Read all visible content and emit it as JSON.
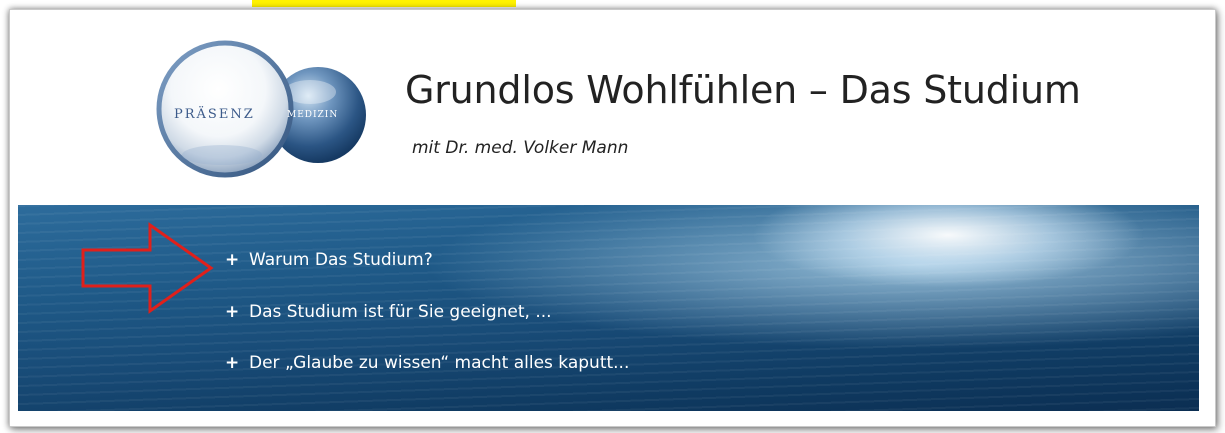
{
  "logo": {
    "word_1": "PRÄSENZ",
    "word_2": "MEDIZIN"
  },
  "header": {
    "title": "Grundlos Wohlfühlen – Das Studium",
    "subtitle": "mit Dr. med. Volker Mann"
  },
  "menu": {
    "bullet": "+",
    "items": [
      {
        "label": "Warum Das Studium?"
      },
      {
        "label": "Das Studium ist für Sie geeignet, ..."
      },
      {
        "label": "Der „Glaube zu wissen“ macht alles kaputt..."
      }
    ]
  },
  "annotation": {
    "arrow_icon": "right-arrow-outline-icon",
    "arrow_color": "#e0201b",
    "highlight_color": "#fff200"
  },
  "colors": {
    "banner_dark": "#0b2e52",
    "banner_mid": "#1f5a88",
    "text_dark": "#222222"
  }
}
